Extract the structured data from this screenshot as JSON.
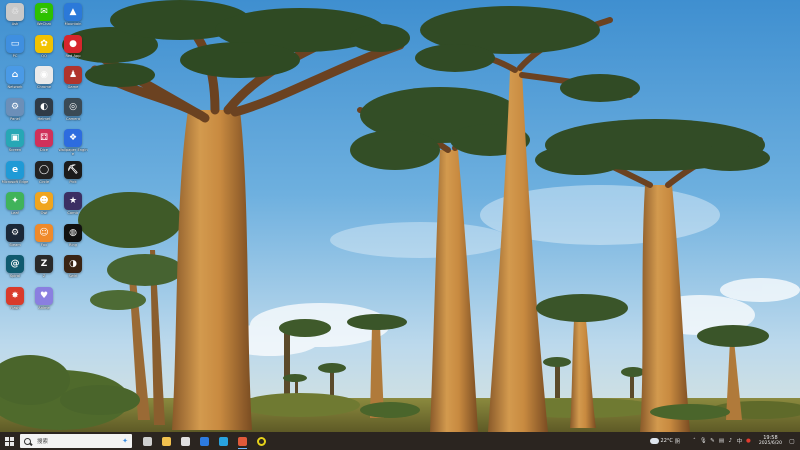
{
  "desktop": {
    "icons": [
      {
        "label": "Ash",
        "icon": "recycle-bin-icon",
        "color": "#c9c9c9",
        "glyph": "♲"
      },
      {
        "label": "WeChat",
        "icon": "wechat-icon",
        "color": "#2dc100",
        "glyph": "✉"
      },
      {
        "label": "Mountain",
        "icon": "mountain-app-icon",
        "color": "#2b79d9",
        "glyph": "▲"
      },
      {
        "label": "PC",
        "icon": "this-pc-icon",
        "color": "#3f8fe0",
        "glyph": "▭"
      },
      {
        "label": "QQ",
        "icon": "qq-icon",
        "color": "#f2c200",
        "glyph": "✿"
      },
      {
        "label": "Red App",
        "icon": "red-app-icon",
        "color": "#d6262d",
        "glyph": "●"
      },
      {
        "label": "Network",
        "icon": "network-icon",
        "color": "#4a9ae6",
        "glyph": "⌂"
      },
      {
        "label": "Chrome",
        "icon": "chrome-icon",
        "color": "#eaeaea",
        "glyph": "◉"
      },
      {
        "label": "Game",
        "icon": "game-icon",
        "color": "#b0342d",
        "glyph": "♟"
      },
      {
        "label": "Panel",
        "icon": "control-panel-icon",
        "color": "#6c8fb8",
        "glyph": "⚙"
      },
      {
        "label": "Helmet",
        "icon": "helmet-app-icon",
        "color": "#2f3b47",
        "glyph": "◐"
      },
      {
        "label": "Camera",
        "icon": "camera-app-icon",
        "color": "#3a4a55",
        "glyph": "◎"
      },
      {
        "label": "Screen",
        "icon": "screen-app-icon",
        "color": "#27a7b5",
        "glyph": "▣"
      },
      {
        "label": "Dice",
        "icon": "dice-app-icon",
        "color": "#d0315a",
        "glyph": "⚃"
      },
      {
        "label": "Wallpaper Engine",
        "icon": "wallpaper-engine-icon",
        "color": "#2d6cdf",
        "glyph": "❖"
      },
      {
        "label": "Microsoft Edge",
        "icon": "edge-icon",
        "color": "#1f9ad6",
        "glyph": "e"
      },
      {
        "label": "Circle",
        "icon": "circle-app-icon",
        "color": "#222222",
        "glyph": "◯"
      },
      {
        "label": "Pick",
        "icon": "pickaxe-app-icon",
        "color": "#1b1b1b",
        "glyph": "⛏"
      },
      {
        "label": "Leaf",
        "icon": "leaf-app-icon",
        "color": "#40b35a",
        "glyph": "✦"
      },
      {
        "label": "Owl",
        "icon": "owl-app-icon",
        "color": "#f0a51e",
        "glyph": "☻"
      },
      {
        "label": "Comic",
        "icon": "comic-app-icon",
        "color": "#3b2f63",
        "glyph": "★"
      },
      {
        "label": "Steam",
        "icon": "steam-icon",
        "color": "#1b2838",
        "glyph": "⚙"
      },
      {
        "label": "Fox",
        "icon": "fox-app-icon",
        "color": "#f08a2a",
        "glyph": "☺"
      },
      {
        "label": "Ring",
        "icon": "ring-app-icon",
        "color": "#111111",
        "glyph": "◍"
      },
      {
        "label": "Spiral",
        "icon": "spiral-app-icon",
        "color": "#0f5a6e",
        "glyph": "@"
      },
      {
        "label": "Z",
        "icon": "z-app-icon",
        "color": "#2a2a2a",
        "glyph": "Z"
      },
      {
        "label": "Swirl",
        "icon": "swirl-app-icon",
        "color": "#3a2414",
        "glyph": "◑"
      },
      {
        "label": "Flash",
        "icon": "flash-app-icon",
        "color": "#d93b2b",
        "glyph": "✸"
      },
      {
        "label": "Anime",
        "icon": "anime-app-icon",
        "color": "#8a7fe0",
        "glyph": "♥"
      }
    ]
  },
  "taskbar": {
    "search_label": "搜索",
    "apps": [
      {
        "icon": "task-view-icon",
        "color": "#d0d0d0"
      },
      {
        "icon": "file-explorer-icon",
        "color": "#f2c14e"
      },
      {
        "icon": "store-icon",
        "color": "#e0e0e0"
      },
      {
        "icon": "mail-icon",
        "color": "#2d7be0"
      },
      {
        "icon": "edge-taskbar-icon",
        "color": "#29a3df"
      },
      {
        "icon": "image-app-icon",
        "color": "#e05a3a"
      },
      {
        "icon": "yellow-circle-icon",
        "color": "#e6d21a"
      }
    ],
    "weather": {
      "temp": "22°C",
      "condition": "阴"
    },
    "clock": {
      "time": "19:58",
      "date": "2025/6/20"
    }
  }
}
